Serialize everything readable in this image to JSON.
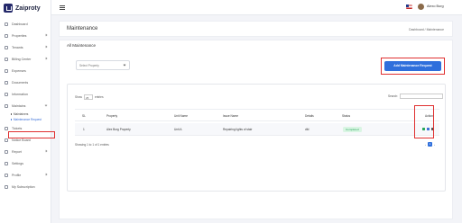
{
  "brand": {
    "name": "Zaiproty"
  },
  "sidebar": {
    "items": [
      {
        "label": "Dashboard",
        "icon": "home-icon"
      },
      {
        "label": "Properties",
        "icon": "building-icon",
        "has_children": true
      },
      {
        "label": "Tenants",
        "icon": "users-icon",
        "has_children": true
      },
      {
        "label": "Billing Center",
        "icon": "invoice-icon",
        "has_children": true
      },
      {
        "label": "Expenses",
        "icon": "wallet-icon"
      },
      {
        "label": "Documents",
        "icon": "document-icon"
      },
      {
        "label": "Information",
        "icon": "info-icon"
      },
      {
        "label": "Maintains",
        "icon": "wrench-icon",
        "has_children": true,
        "open": true
      },
      {
        "label": "Tickets",
        "icon": "ticket-icon"
      },
      {
        "label": "Notice Board",
        "icon": "megaphone-icon"
      },
      {
        "label": "Report",
        "icon": "chart-icon",
        "has_children": true
      },
      {
        "label": "Settings",
        "icon": "gear-icon"
      },
      {
        "label": "Profile",
        "icon": "user-icon",
        "has_children": true
      },
      {
        "label": "My Subscription",
        "icon": "card-icon"
      }
    ],
    "subitems": [
      {
        "label": "Maintainers",
        "active": false
      },
      {
        "label": "Maintenance Request",
        "active": true
      }
    ]
  },
  "header": {
    "user_name": "Alexo Burg",
    "flag": "us-flag-icon"
  },
  "page": {
    "title": "Maintenance",
    "breadcrumb": "Dashboard  /  Maintenance"
  },
  "card": {
    "title": "All Maintenance",
    "property_select_placeholder": "Select Property",
    "add_button": "Add Maintenance Request"
  },
  "table": {
    "show_label": "Show",
    "show_value": "25",
    "entries_label": "entries",
    "search_label": "Search:",
    "columns": [
      "SL",
      "Property",
      "Unit Name",
      "Issue Name",
      "Details",
      "Status",
      "Action"
    ],
    "rows": [
      {
        "sl": "1",
        "property": "Alex Burg Property",
        "unit": "Unit A",
        "issue": "Repairing lights of stair",
        "details": "dfd",
        "status": "Completed"
      }
    ],
    "showing_text": "Showing 1 to 1 of 1 entries",
    "page": "1",
    "prev": "‹",
    "next": "›"
  },
  "colors": {
    "accent": "#2f6fdc",
    "status_completed_bg": "#d9f5e3",
    "status_completed_text": "#26a55a",
    "highlight": "#e03030"
  }
}
